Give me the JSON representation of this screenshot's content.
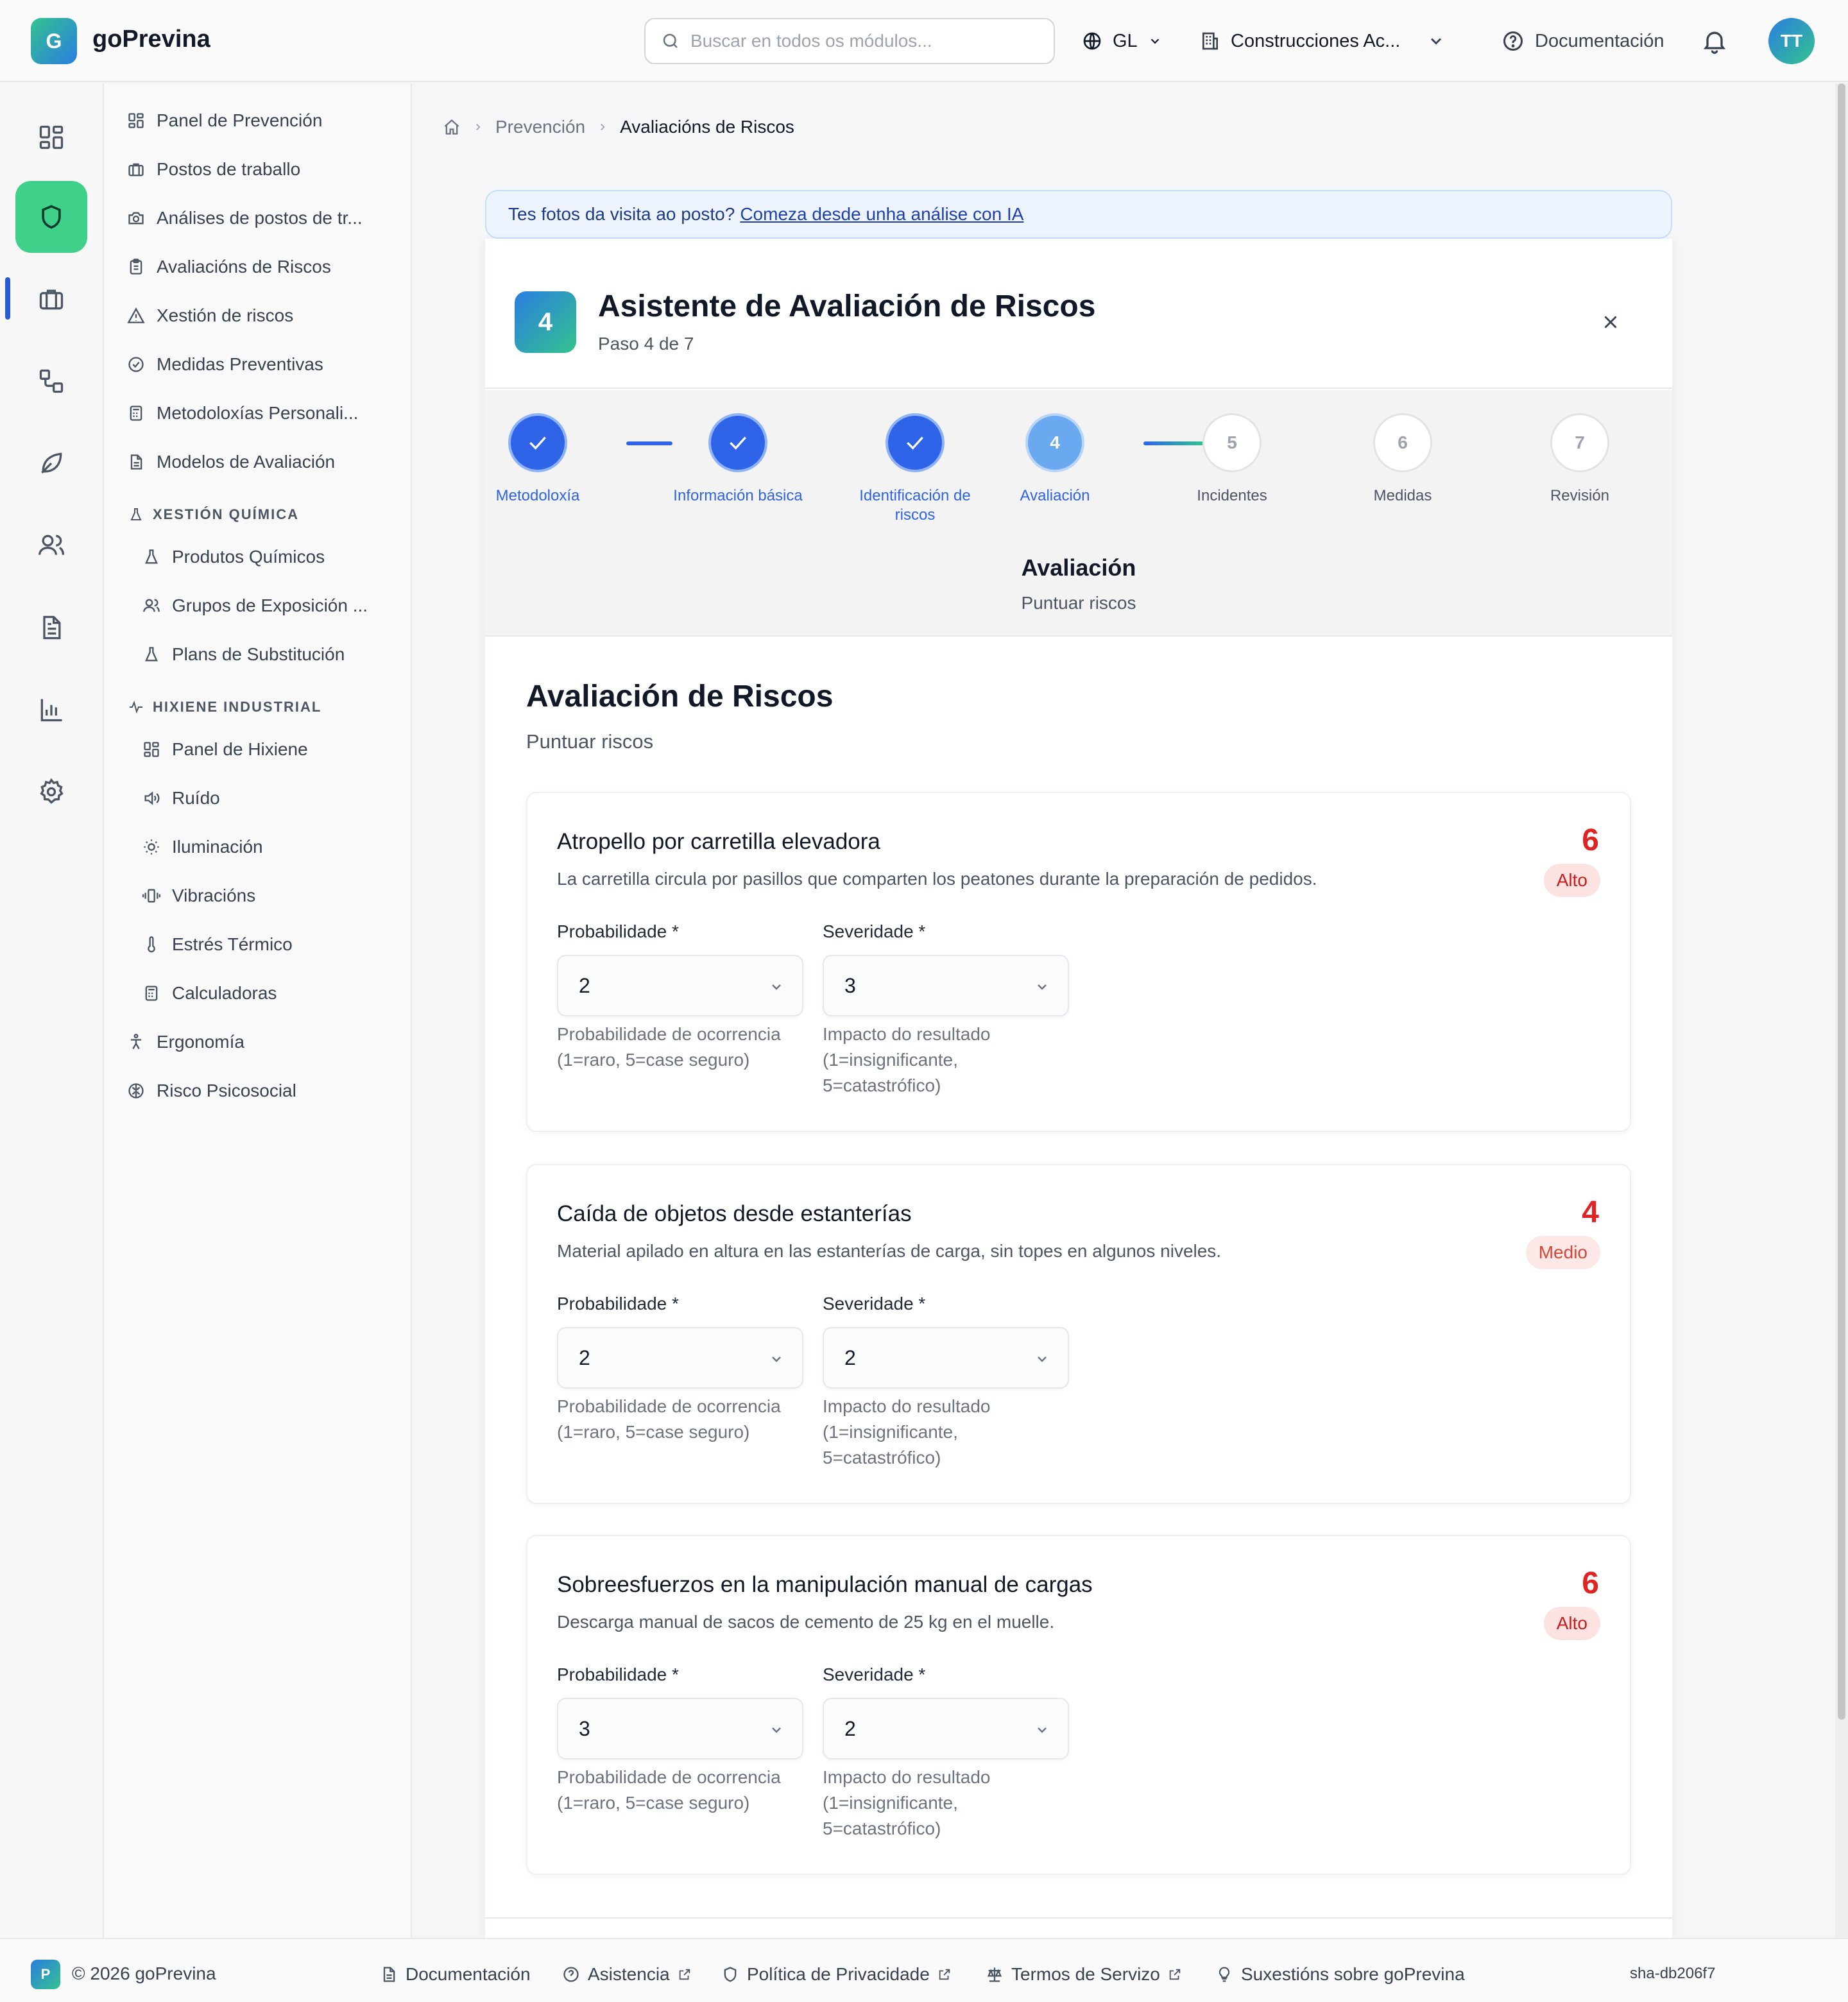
{
  "app": {
    "logo_letter": "G",
    "name": "goPrevina"
  },
  "header": {
    "search_placeholder": "Buscar en todos os módulos...",
    "language": "GL",
    "company": "Construcciones Ac...",
    "docs": "Documentación",
    "avatar": "TT"
  },
  "sidebar": {
    "items": [
      {
        "label": "Panel de Prevención",
        "icon": "dashboard-icon"
      },
      {
        "label": "Postos de traballo",
        "icon": "briefcase-icon"
      },
      {
        "label": "Análises de postos de tr...",
        "icon": "camera-icon"
      },
      {
        "label": "Avaliacións de Riscos",
        "icon": "clipboard-icon"
      },
      {
        "label": "Xestión de riscos",
        "icon": "warning-icon"
      },
      {
        "label": "Medidas Preventivas",
        "icon": "check-circle-icon"
      },
      {
        "label": "Metodoloxías Personali...",
        "icon": "calculator-icon"
      },
      {
        "label": "Modelos de Avaliación",
        "icon": "document-icon"
      }
    ],
    "chem_section": "XESTIÓN QUÍMICA",
    "chem_items": [
      "Produtos Químicos",
      "Grupos de Exposición ...",
      "Plans de Substitución"
    ],
    "hyg_section": "HIXIENE INDUSTRIAL",
    "hyg_items": [
      "Panel de Hixiene",
      "Ruído",
      "Iluminación",
      "Vibracións",
      "Estrés Térmico",
      "Calculadoras"
    ],
    "bottom_items": [
      "Ergonomía",
      "Risco Psicosocial"
    ]
  },
  "breadcrumb": {
    "parent": "Prevención",
    "current": "Avaliacións de Riscos"
  },
  "banner": {
    "text": "Tes fotos da visita ao posto?",
    "link": "Comeza desde unha análise con IA"
  },
  "wizard": {
    "badge": "4",
    "title": "Asistente de Avaliación de Riscos",
    "subtitle": "Paso 4 de 7",
    "steps": [
      {
        "num": "1",
        "label": "Metodoloxía",
        "state": "done"
      },
      {
        "num": "2",
        "label": "Información básica",
        "state": "done"
      },
      {
        "num": "3",
        "label": "Identificación de riscos",
        "state": "done"
      },
      {
        "num": "4",
        "label": "Avaliación",
        "state": "active"
      },
      {
        "num": "5",
        "label": "Incidentes",
        "state": "todo"
      },
      {
        "num": "6",
        "label": "Medidas",
        "state": "todo"
      },
      {
        "num": "7",
        "label": "Revisión",
        "state": "todo"
      }
    ],
    "current_step_title": "Avaliación",
    "current_step_desc": "Puntuar riscos"
  },
  "section": {
    "title": "Avaliación de Riscos",
    "subtitle": "Puntuar riscos"
  },
  "field_labels": {
    "probability": "Probabilidade *",
    "severity": "Severidade *",
    "probability_help": "Probabilidade de ocorrencia (1=raro, 5=case seguro)",
    "severity_help": "Impacto do resultado (1=insignificante, 5=catastrófico)"
  },
  "risks": [
    {
      "title": "Atropello por carretilla elevadora",
      "description": "La carretilla circula por pasillos que comparten los peatones durante la preparación de pedidos.",
      "score": "6",
      "level": "Alto",
      "probability": "2",
      "severity": "3"
    },
    {
      "title": "Caída de objetos desde estanterías",
      "description": "Material apilado en altura en las estanterías de carga, sin topes en algunos niveles.",
      "score": "4",
      "level": "Medio",
      "probability": "2",
      "severity": "2"
    },
    {
      "title": "Sobreesfuerzos en la manipulación manual de cargas",
      "description": "Descarga manual de sacos de cemento de 25 kg en el muelle.",
      "score": "6",
      "level": "Alto",
      "probability": "3",
      "severity": "2"
    }
  ],
  "footer": {
    "logo_letter": "P",
    "copyright": "© 2026 goPrevina",
    "links": [
      "Documentación",
      "Asistencia",
      "Política de Privacidade",
      "Termos de Servizo",
      "Suxestións sobre goPrevina"
    ],
    "sha": "sha-db206f7"
  },
  "colors": {
    "primary": "#2f63e8",
    "accent_green": "#3fd18a",
    "risk_red": "#e02424"
  }
}
